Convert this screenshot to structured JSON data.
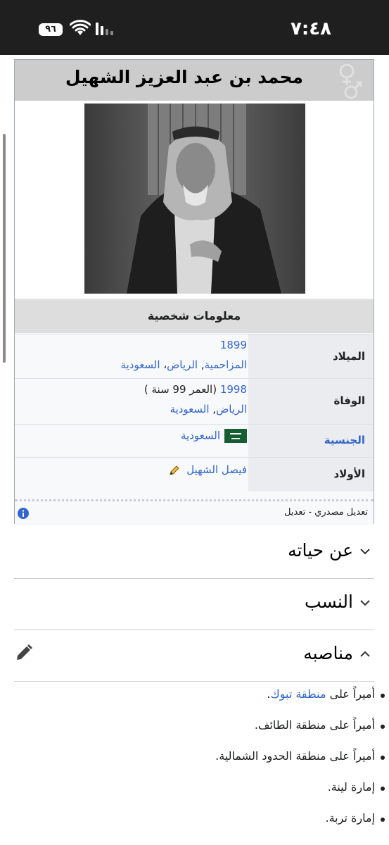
{
  "status_bar": {
    "time": "٧:٤٨",
    "battery": "٩٦",
    "wifi_icon": "wifi-icon",
    "signal_icon": "signal-icon"
  },
  "infobox": {
    "title": "محمد بن عبد العزيز الشهيل",
    "gender_icon": "gender-symbol-icon",
    "photo_alt": "portrait-photo",
    "section_header": "معلومات شخصية",
    "rows": [
      {
        "label": "الميلاد",
        "line1": "1899",
        "line2_a": "المزاحمية",
        "sep": ", ",
        "line2_b": "الرياض",
        "line2_c": "السعودية"
      },
      {
        "label": "الوفاة",
        "year": "1998",
        "age": " (العمر 99 سنة )",
        "line2_a": "الرياض",
        "sep": ", ",
        "line2_b": "السعودية"
      },
      {
        "label": "الجنسية",
        "value": "السعودية",
        "flag_icon": "saudi-flag-icon"
      },
      {
        "label": "الأولاد",
        "value": "فيصل الشهيل",
        "edit_icon": "pencil-icon"
      }
    ],
    "footer": "تعديل مصدري - تعديل",
    "info_icon": "info-icon"
  },
  "sections": [
    {
      "title": "عن حياته",
      "state": "collapsed"
    },
    {
      "title": "النسب",
      "state": "collapsed"
    },
    {
      "title": "مناصبه",
      "state": "expanded",
      "edit_icon": "pencil-icon"
    }
  ],
  "positions": [
    {
      "prefix": "أميراً على ",
      "link": "منطقة تبوك",
      "suffix": "."
    },
    {
      "text": "أميراً على منطقة الطائف."
    },
    {
      "text": "أميراً على منطقة الحدود الشمالية."
    },
    {
      "text": "إمارة لينة."
    },
    {
      "text": "إمارة تربة."
    }
  ],
  "colors": {
    "link": "#3366cc",
    "title_bg": "#cccccc",
    "label_bg": "#eaecf0",
    "status_bar_bg": "#1f1f1f"
  }
}
